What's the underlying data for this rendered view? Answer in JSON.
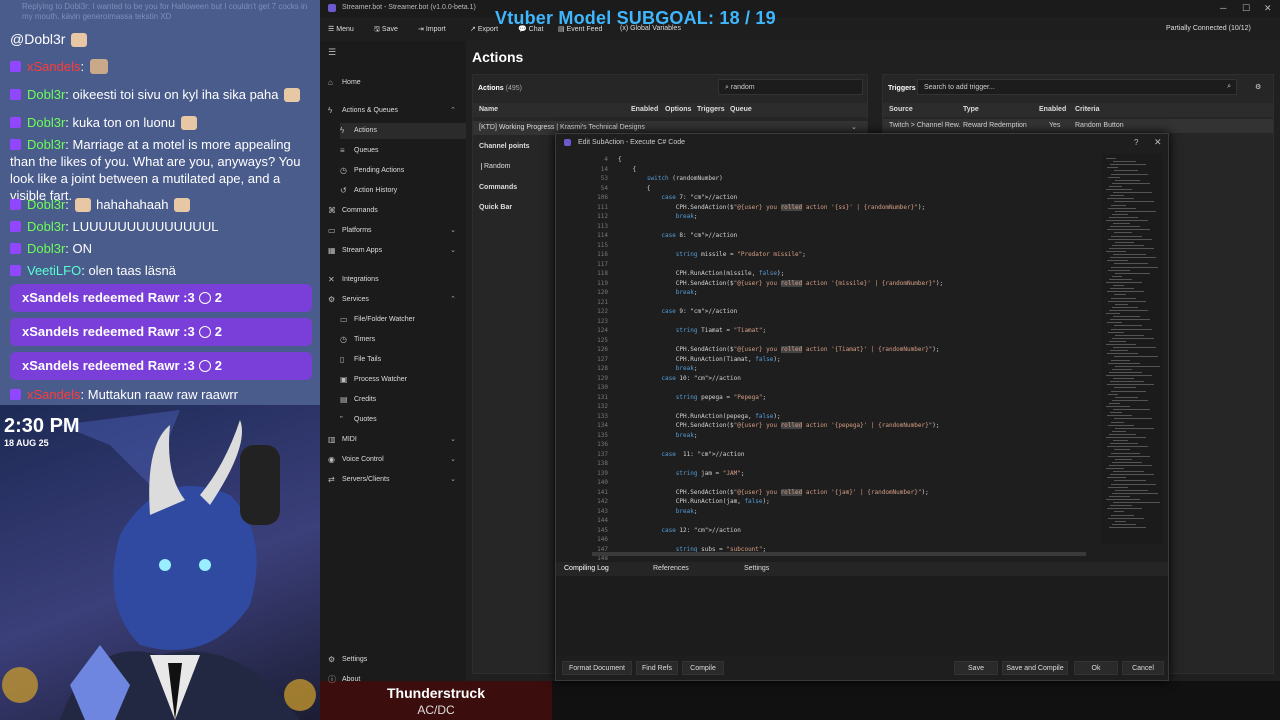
{
  "chat": {
    "reply_hint": "Replying to Dobl3r: I wanted to be you for Halloween but I couldn't get 7 cocks in my mouth. kävin generoimassa tekstin XD",
    "mention": "@Dobl3r",
    "messages": [
      {
        "user": "xSandels",
        "sep": ":",
        "text": ""
      },
      {
        "user": "Dobl3r",
        "sep": ":",
        "text": "oikeesti toi sivu on kyl iha sika paha"
      },
      {
        "user": "Dobl3r",
        "sep": ":",
        "text": "kuka ton on luonu"
      },
      {
        "user": "Dobl3r",
        "sep": ":",
        "text": "Marriage at a motel is more appealing than the likes of you. What are you, anyways? You look like a joint between a mutilated ape, and a visible fart."
      },
      {
        "user": "Dobl3r",
        "sep": ":",
        "text": "hahahahaah"
      },
      {
        "user": "Dobl3r",
        "sep": ":",
        "text": "LUUUUUUUUUUUUUUL"
      },
      {
        "user": "Dobl3r",
        "sep": ":",
        "text": "ON"
      },
      {
        "user": "VeetiLFO",
        "sep": ":",
        "text": "olen taas läsnä"
      },
      {
        "user": "xSandels",
        "sep": ":",
        "text": "Muttakun raaw raw raawrr"
      }
    ],
    "redeems": [
      {
        "text": "xSandels redeemed Rawr :3",
        "count": "2"
      },
      {
        "text": "xSandels redeemed Rawr :3",
        "count": "2"
      },
      {
        "text": "xSandels redeemed Rawr :3",
        "count": "2"
      }
    ],
    "colors": {
      "panel": "#4a5c8c",
      "redeem": "#7a3fd8",
      "green": "#6cff57",
      "red": "#ff3b3b"
    }
  },
  "stream": {
    "time": "2:30 PM",
    "date": "18 AUG 25",
    "subgoal": "Vtuber Model SUBGOAL: 18 / 19",
    "now_playing_title": "Thunderstruck",
    "now_playing_artist": "AC/DC"
  },
  "app": {
    "title": "Streamer.bot - Streamer.bot (v1.0.0-beta.1)",
    "menu": [
      "Menu",
      "Save",
      "Import",
      "Export",
      "Chat",
      "Event Feed",
      "Global Variables"
    ],
    "status": "Partially Connected (10/12)",
    "page_title": "Actions"
  },
  "sidebar": {
    "items": [
      {
        "label": "Home",
        "sub": false
      },
      {
        "label": "Actions & Queues",
        "sub": false
      },
      {
        "label": "Actions",
        "sub": true
      },
      {
        "label": "Queues",
        "sub": true
      },
      {
        "label": "Pending Actions",
        "sub": true
      },
      {
        "label": "Action History",
        "sub": true
      },
      {
        "label": "Commands",
        "sub": false
      },
      {
        "label": "Platforms",
        "sub": false
      },
      {
        "label": "Stream Apps",
        "sub": false
      },
      {
        "label": "Integrations",
        "sub": false
      },
      {
        "label": "Services",
        "sub": false
      },
      {
        "label": "File/Folder Watcher",
        "sub": true
      },
      {
        "label": "Timers",
        "sub": true
      },
      {
        "label": "File Tails",
        "sub": true
      },
      {
        "label": "Process Watcher",
        "sub": true
      },
      {
        "label": "Credits",
        "sub": true
      },
      {
        "label": "Quotes",
        "sub": true
      },
      {
        "label": "MIDI",
        "sub": false
      },
      {
        "label": "Voice Control",
        "sub": false
      },
      {
        "label": "Servers/Clients",
        "sub": false
      },
      {
        "label": "Settings",
        "sub": false
      },
      {
        "label": "About",
        "sub": false
      }
    ]
  },
  "actions_panel": {
    "header": "Actions",
    "count": "(495)",
    "search_value": "random",
    "columns": [
      "Name",
      "Enabled",
      "Options",
      "Triggers",
      "Queue"
    ],
    "group": "[KTD] Working Progress | Krasmi's Technical Designs",
    "rows": [
      "Channel points",
      "Random",
      "Commands",
      "Quick Bar"
    ]
  },
  "triggers_panel": {
    "header": "Triggers",
    "search_placeholder": "Search to add trigger...",
    "columns": [
      "Source",
      "Type",
      "Enabled",
      "Criteria"
    ],
    "row": {
      "source": "Twitch > Channel Rew.",
      "type": "Reward Redemption",
      "enabled": "Yes",
      "criteria": "Random Button"
    }
  },
  "editor": {
    "title": "Edit SubAction - Execute C# Code",
    "tabs": [
      "Compiling Log",
      "References",
      "Settings"
    ],
    "buttons_left": [
      "Format Document",
      "Find Refs",
      "Compile"
    ],
    "buttons_right": [
      "Save",
      "Save and Compile",
      "Ok",
      "Cancel"
    ],
    "lines": [
      {
        "n": "4",
        "t": "{"
      },
      {
        "n": "14",
        "t": "    {"
      },
      {
        "n": "53",
        "t": "        switch (randomNumber)"
      },
      {
        "n": "54",
        "t": "        {"
      },
      {
        "n": "106",
        "t": "            case 7: //action"
      },
      {
        "n": "111",
        "t": "                CPH.SendAction($\"@{user} you rolled action '{ss}' | {randomNumber}\");"
      },
      {
        "n": "112",
        "t": "                break;"
      },
      {
        "n": "113",
        "t": ""
      },
      {
        "n": "114",
        "t": "            case 8: //action"
      },
      {
        "n": "115",
        "t": ""
      },
      {
        "n": "116",
        "t": "                string missile = \"Predator missile\";"
      },
      {
        "n": "117",
        "t": ""
      },
      {
        "n": "118",
        "t": "                CPH.RunAction(missile, false);"
      },
      {
        "n": "119",
        "t": "                CPH.SendAction($\"@{user} you rolled action '{missile}' | {randomNumber}\");"
      },
      {
        "n": "120",
        "t": "                break;"
      },
      {
        "n": "121",
        "t": ""
      },
      {
        "n": "122",
        "t": "            case 9: //action"
      },
      {
        "n": "123",
        "t": ""
      },
      {
        "n": "124",
        "t": "                string Tiamat = \"Tiamat\";"
      },
      {
        "n": "125",
        "t": ""
      },
      {
        "n": "126",
        "t": "                CPH.SendAction($\"@{user} you rolled action '{Tiamat}' | {randomNumber}\");"
      },
      {
        "n": "127",
        "t": "                CPH.RunAction(Tiamat, false);"
      },
      {
        "n": "128",
        "t": "                break;"
      },
      {
        "n": "129",
        "t": "            case 10: //action"
      },
      {
        "n": "130",
        "t": ""
      },
      {
        "n": "131",
        "t": "                string pepega = \"Pepega\";"
      },
      {
        "n": "132",
        "t": ""
      },
      {
        "n": "133",
        "t": "                CPH.RunAction(pepega, false);"
      },
      {
        "n": "134",
        "t": "                CPH.SendAction($\"@{user} you rolled action '{pepega}' | {randomNumber}\");"
      },
      {
        "n": "135",
        "t": "                break;"
      },
      {
        "n": "136",
        "t": ""
      },
      {
        "n": "137",
        "t": "            case  11: //action"
      },
      {
        "n": "138",
        "t": ""
      },
      {
        "n": "139",
        "t": "                string jam = \"JAM\";"
      },
      {
        "n": "140",
        "t": ""
      },
      {
        "n": "141",
        "t": "                CPH.SendAction($\"@{user} you rolled action '{jam}' | {randomNumber}\");"
      },
      {
        "n": "142",
        "t": "                CPH.RunAction(jam, false);"
      },
      {
        "n": "143",
        "t": "                break;"
      },
      {
        "n": "144",
        "t": ""
      },
      {
        "n": "145",
        "t": "            case 12: //action"
      },
      {
        "n": "146",
        "t": ""
      },
      {
        "n": "147",
        "t": "                string subs = \"subcount\";"
      },
      {
        "n": "148",
        "t": ""
      }
    ]
  }
}
